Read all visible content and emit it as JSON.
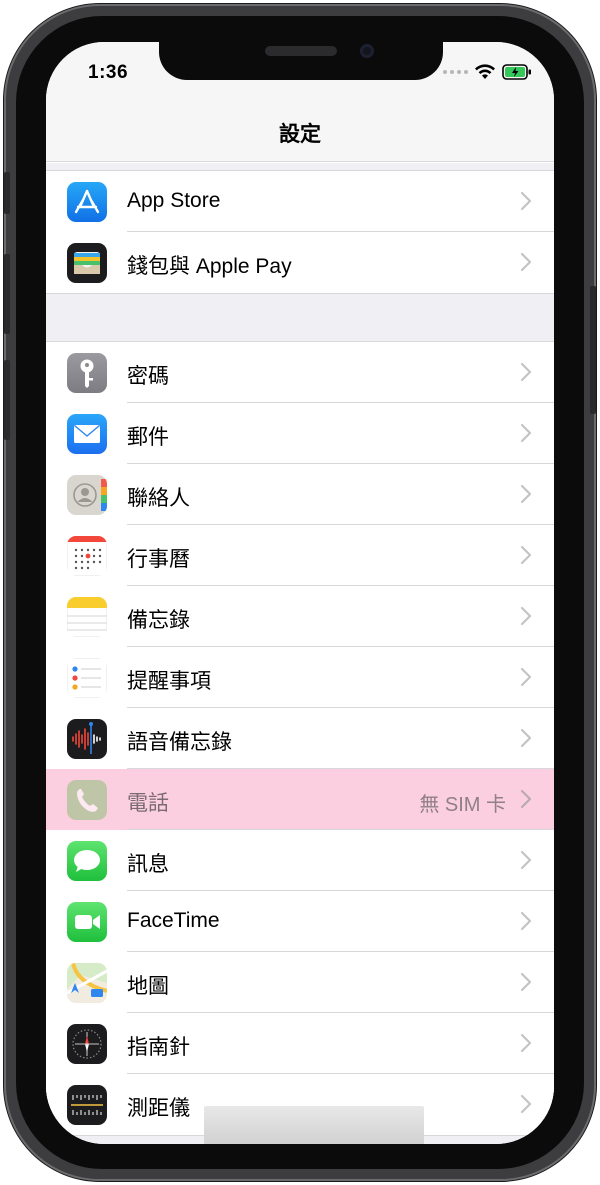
{
  "status_bar": {
    "time": "1:36"
  },
  "nav": {
    "title": "設定"
  },
  "group1": [
    {
      "id": "app-store",
      "label": "App Store",
      "icon": "app-store-icon",
      "color": "#1a8cf0"
    },
    {
      "id": "wallet",
      "label": "錢包與 Apple Pay",
      "icon": "wallet-icon",
      "color": "#1c1c1e"
    }
  ],
  "group2": [
    {
      "id": "passwords",
      "label": "密碼",
      "icon": "key-icon",
      "color": "#8e8e93"
    },
    {
      "id": "mail",
      "label": "郵件",
      "icon": "mail-icon",
      "color": "#1e8ef5"
    },
    {
      "id": "contacts",
      "label": "聯絡人",
      "icon": "contacts-icon",
      "color": "#d8d5cf"
    },
    {
      "id": "calendar",
      "label": "行事曆",
      "icon": "calendar-icon",
      "color": "#ffffff"
    },
    {
      "id": "notes",
      "label": "備忘錄",
      "icon": "notes-icon",
      "color": "#ffffff"
    },
    {
      "id": "reminders",
      "label": "提醒事項",
      "icon": "reminders-icon",
      "color": "#ffffff"
    },
    {
      "id": "voice-memos",
      "label": "語音備忘錄",
      "icon": "voice-memos-icon",
      "color": "#1c1c1e"
    },
    {
      "id": "phone",
      "label": "電話",
      "value": "無 SIM 卡",
      "icon": "phone-icon",
      "color": "#34c759",
      "highlighted": true
    },
    {
      "id": "messages",
      "label": "訊息",
      "icon": "messages-icon",
      "color": "#34c759"
    },
    {
      "id": "facetime",
      "label": "FaceTime",
      "icon": "facetime-icon",
      "color": "#34c759"
    },
    {
      "id": "maps",
      "label": "地圖",
      "icon": "maps-icon",
      "color": "#cfe6c6"
    },
    {
      "id": "compass",
      "label": "指南針",
      "icon": "compass-icon",
      "color": "#1c1c1e"
    },
    {
      "id": "measure",
      "label": "測距儀",
      "icon": "measure-icon",
      "color": "#1c1c1e"
    }
  ]
}
